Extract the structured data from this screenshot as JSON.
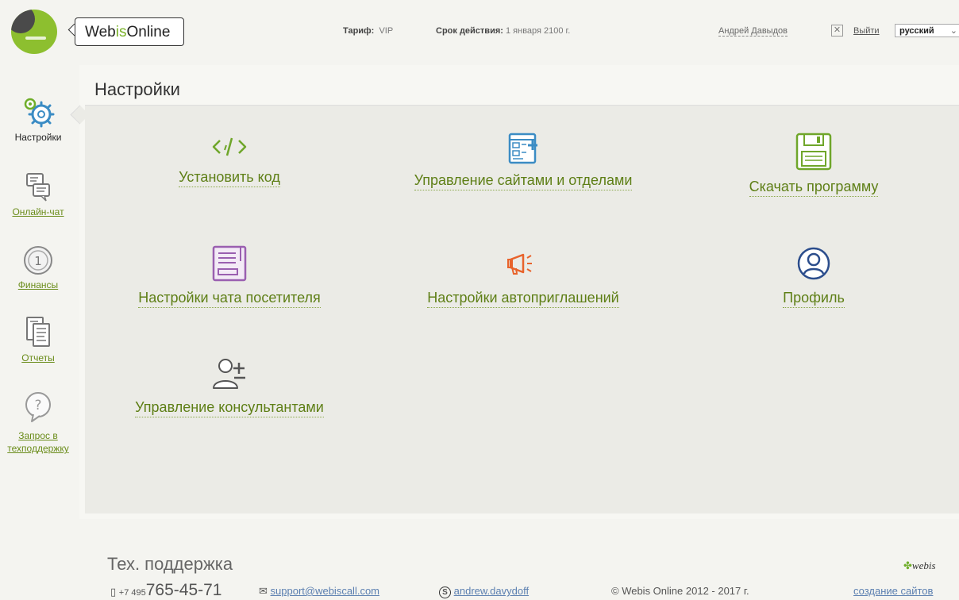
{
  "header": {
    "logo_web": "Web",
    "logo_is": "is",
    "logo_online": "Online",
    "tariff_label": "Тариф:",
    "tariff_value": "VIP",
    "validity_label": "Срок действия:",
    "validity_value": "1 января 2100 г.",
    "user_name": "Андрей Давыдов",
    "logout_label": "Выйти",
    "language": "русский"
  },
  "sidebar": {
    "items": [
      {
        "label": "Настройки",
        "icon": "gear-icon",
        "active": true
      },
      {
        "label": "Онлайн-чат",
        "icon": "chat-icon",
        "active": false
      },
      {
        "label": "Финансы",
        "icon": "coin-icon",
        "active": false
      },
      {
        "label": "Отчеты",
        "icon": "report-icon",
        "active": false
      },
      {
        "label_line1": "Запрос в",
        "label_line2": "техподдержку",
        "icon": "question-icon",
        "active": false
      }
    ]
  },
  "main": {
    "title": "Настройки",
    "tiles": [
      {
        "label": "Установить код",
        "icon": "code-icon"
      },
      {
        "label": "Управление сайтами и отделами",
        "icon": "sites-icon"
      },
      {
        "label": "Скачать программу",
        "icon": "floppy-icon"
      },
      {
        "label": "Настройки чата посетителя",
        "icon": "chat-settings-icon"
      },
      {
        "label": "Настройки автоприглашений",
        "icon": "megaphone-icon"
      },
      {
        "label": "Профиль",
        "icon": "profile-icon"
      },
      {
        "label": "Управление консультантами",
        "icon": "add-user-icon"
      }
    ],
    "colors": {
      "green": "#6fa62a",
      "blue": "#3b8cc4",
      "purple": "#9a5fb0",
      "orange": "#e8632b",
      "navy": "#2b4d8c",
      "gray": "#555555"
    }
  },
  "footer": {
    "support_title": "Тех. поддержка",
    "phone_prefix": "+7 495",
    "phone_number": "765-45-71",
    "email": "support@webiscall.com",
    "skype": "andrew.davydoff",
    "copyright": "© Webis Online 2012 - 2017 г.",
    "group_logo": "webis",
    "site_link": "создание сайтов"
  }
}
